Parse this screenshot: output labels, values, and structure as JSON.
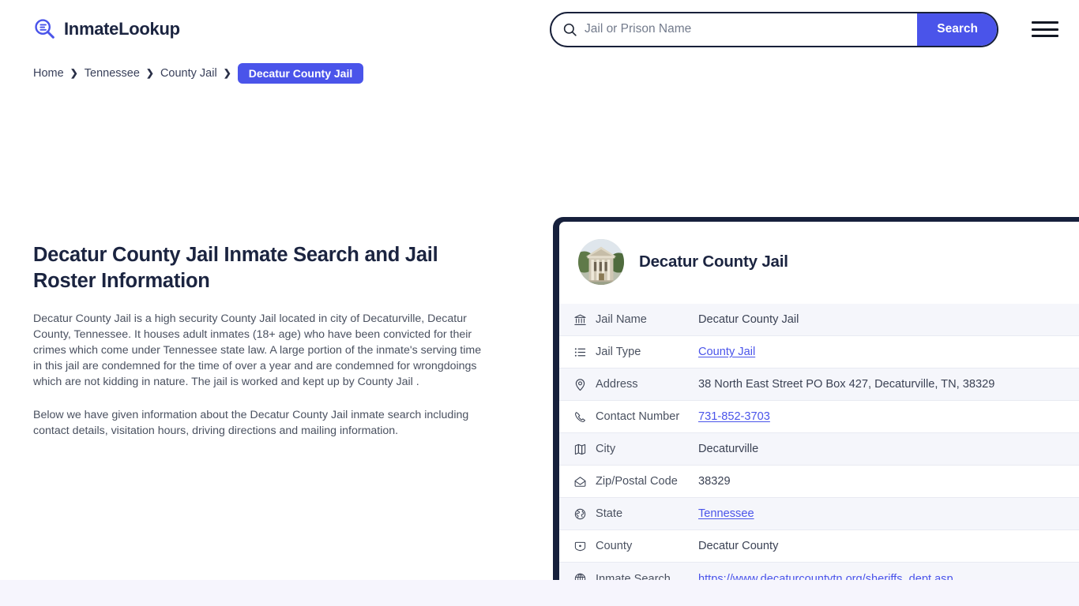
{
  "header": {
    "brand_name": "InmateLookup",
    "brand_icon": "magnifier-list-icon",
    "search": {
      "placeholder": "Jail or Prison Name",
      "value": "",
      "button_label": "Search",
      "icon": "search-icon"
    },
    "menu_icon": "hamburger-menu-icon"
  },
  "breadcrumb": {
    "items": [
      {
        "label": "Home",
        "current": false
      },
      {
        "label": "Tennessee",
        "current": false
      },
      {
        "label": "County Jail",
        "current": false
      },
      {
        "label": "Decatur County Jail",
        "current": true
      }
    ],
    "separator": "❯"
  },
  "content": {
    "title": "Decatur County Jail Inmate Search and Jail Roster Information",
    "paragraphs": [
      "Decatur County Jail is a high security County Jail located in city of Decaturville, Decatur County, Tennessee. It houses adult inmates (18+ age) who have been convicted for their crimes which come under Tennessee state law. A large portion of the inmate's serving time in this jail are condemned for the time of over a year and are condemned for wrongdoings which are not kidding in nature. The jail is worked and kept up by County Jail .",
      "Below we have given information about the Decatur County Jail inmate search including contact details, visitation hours, driving directions and mailing information."
    ]
  },
  "card": {
    "title": "Decatur County Jail",
    "avatar_icon": "courthouse-photo",
    "rows": [
      {
        "icon": "bank-building-icon",
        "label": "Jail Name",
        "value": "Decatur County Jail",
        "link": false
      },
      {
        "icon": "list-icon",
        "label": "Jail Type",
        "value": "County Jail",
        "link": true
      },
      {
        "icon": "map-pin-icon",
        "label": "Address",
        "value": "38 North East Street PO Box 427, Decaturville, TN, 38329",
        "link": false
      },
      {
        "icon": "phone-icon",
        "label": "Contact Number",
        "value": "731-852-3703",
        "link": true
      },
      {
        "icon": "map-icon",
        "label": "City",
        "value": "Decaturville",
        "link": false
      },
      {
        "icon": "envelope-icon",
        "label": "Zip/Postal Code",
        "value": "38329",
        "link": false
      },
      {
        "icon": "globe-americas-icon",
        "label": "State",
        "value": "Tennessee",
        "link": true
      },
      {
        "icon": "location-box-icon",
        "label": "County",
        "value": "Decatur County",
        "link": false
      },
      {
        "icon": "globe-icon",
        "label": "Inmate Search",
        "value": "https://www.decaturcountytn.org/sheriffs_dept.asp",
        "link": true
      }
    ]
  },
  "colors": {
    "accent": "#4a54ea",
    "dark": "#16203c",
    "row_alt": "#f5f6fb",
    "footer_band": "#f6f5fd"
  }
}
